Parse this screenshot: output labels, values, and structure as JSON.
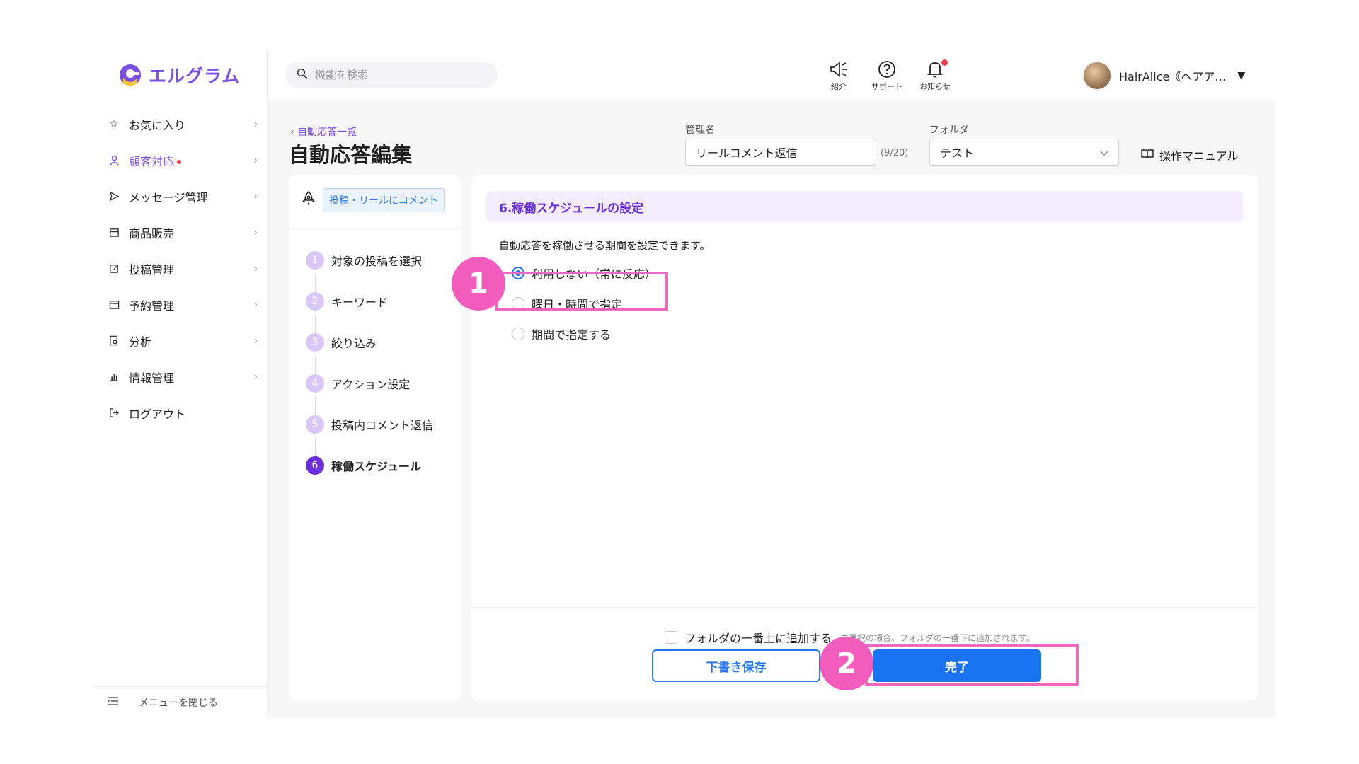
{
  "brand": {
    "name": "エルグラム",
    "accent": "#7b4fe0"
  },
  "sidebar": {
    "items": [
      {
        "label": "お気に入り",
        "icon": "star-icon",
        "active": false
      },
      {
        "label": "顧客対応",
        "icon": "user-icon",
        "active": true
      },
      {
        "label": "メッセージ管理",
        "icon": "send-icon",
        "active": false
      },
      {
        "label": "商品販売",
        "icon": "store-icon",
        "active": false
      },
      {
        "label": "投稿管理",
        "icon": "edit-icon",
        "active": false
      },
      {
        "label": "予約管理",
        "icon": "calendar-icon",
        "active": false
      },
      {
        "label": "分析",
        "icon": "analysis-icon",
        "active": false
      },
      {
        "label": "情報管理",
        "icon": "bar-chart-icon",
        "active": false
      },
      {
        "label": "ログアウト",
        "icon": "logout-icon",
        "active": false
      }
    ],
    "close_menu": "メニューを閉じる"
  },
  "topbar": {
    "search_placeholder": "機能を検索",
    "icons": [
      {
        "label": "紹介",
        "icon": "megaphone-icon"
      },
      {
        "label": "サポート",
        "icon": "help-icon"
      },
      {
        "label": "お知らせ",
        "icon": "bell-icon"
      }
    ],
    "user_name": "HairAlice《ヘアア…"
  },
  "header": {
    "breadcrumb": "自動応答一覧",
    "title": "自動応答編集",
    "name_label": "管理名",
    "name_value": "リールコメント返信",
    "name_counter": "(9/20)",
    "folder_label": "フォルダ",
    "folder_value": "テスト",
    "manual": "操作マニュアル"
  },
  "steps": {
    "trigger": "投稿・リールにコメント",
    "items": [
      {
        "num": "1",
        "label": "対象の投稿を選択"
      },
      {
        "num": "2",
        "label": "キーワード"
      },
      {
        "num": "3",
        "label": "絞り込み"
      },
      {
        "num": "4",
        "label": "アクション設定"
      },
      {
        "num": "5",
        "label": "投稿内コメント返信"
      },
      {
        "num": "6",
        "label": "稼働スケジュール"
      }
    ],
    "current": 6
  },
  "main": {
    "section_title": "6.稼働スケジュールの設定",
    "description": "自動応答を稼働させる期間を設定できます。",
    "options": [
      {
        "label": "利用しない（常に反応）",
        "checked": true
      },
      {
        "label": "曜日・時間で指定",
        "checked": false
      },
      {
        "label": "期間で指定する",
        "checked": false
      }
    ],
    "add_top_label": "フォルダの一番上に追加する",
    "add_top_hint": "未選択の場合、フォルダの一番下に追加されます。",
    "draft_button": "下書き保存",
    "done_button": "完了"
  },
  "annotations": {
    "badge1": "1",
    "badge2": "2",
    "color": "#f066c0"
  }
}
